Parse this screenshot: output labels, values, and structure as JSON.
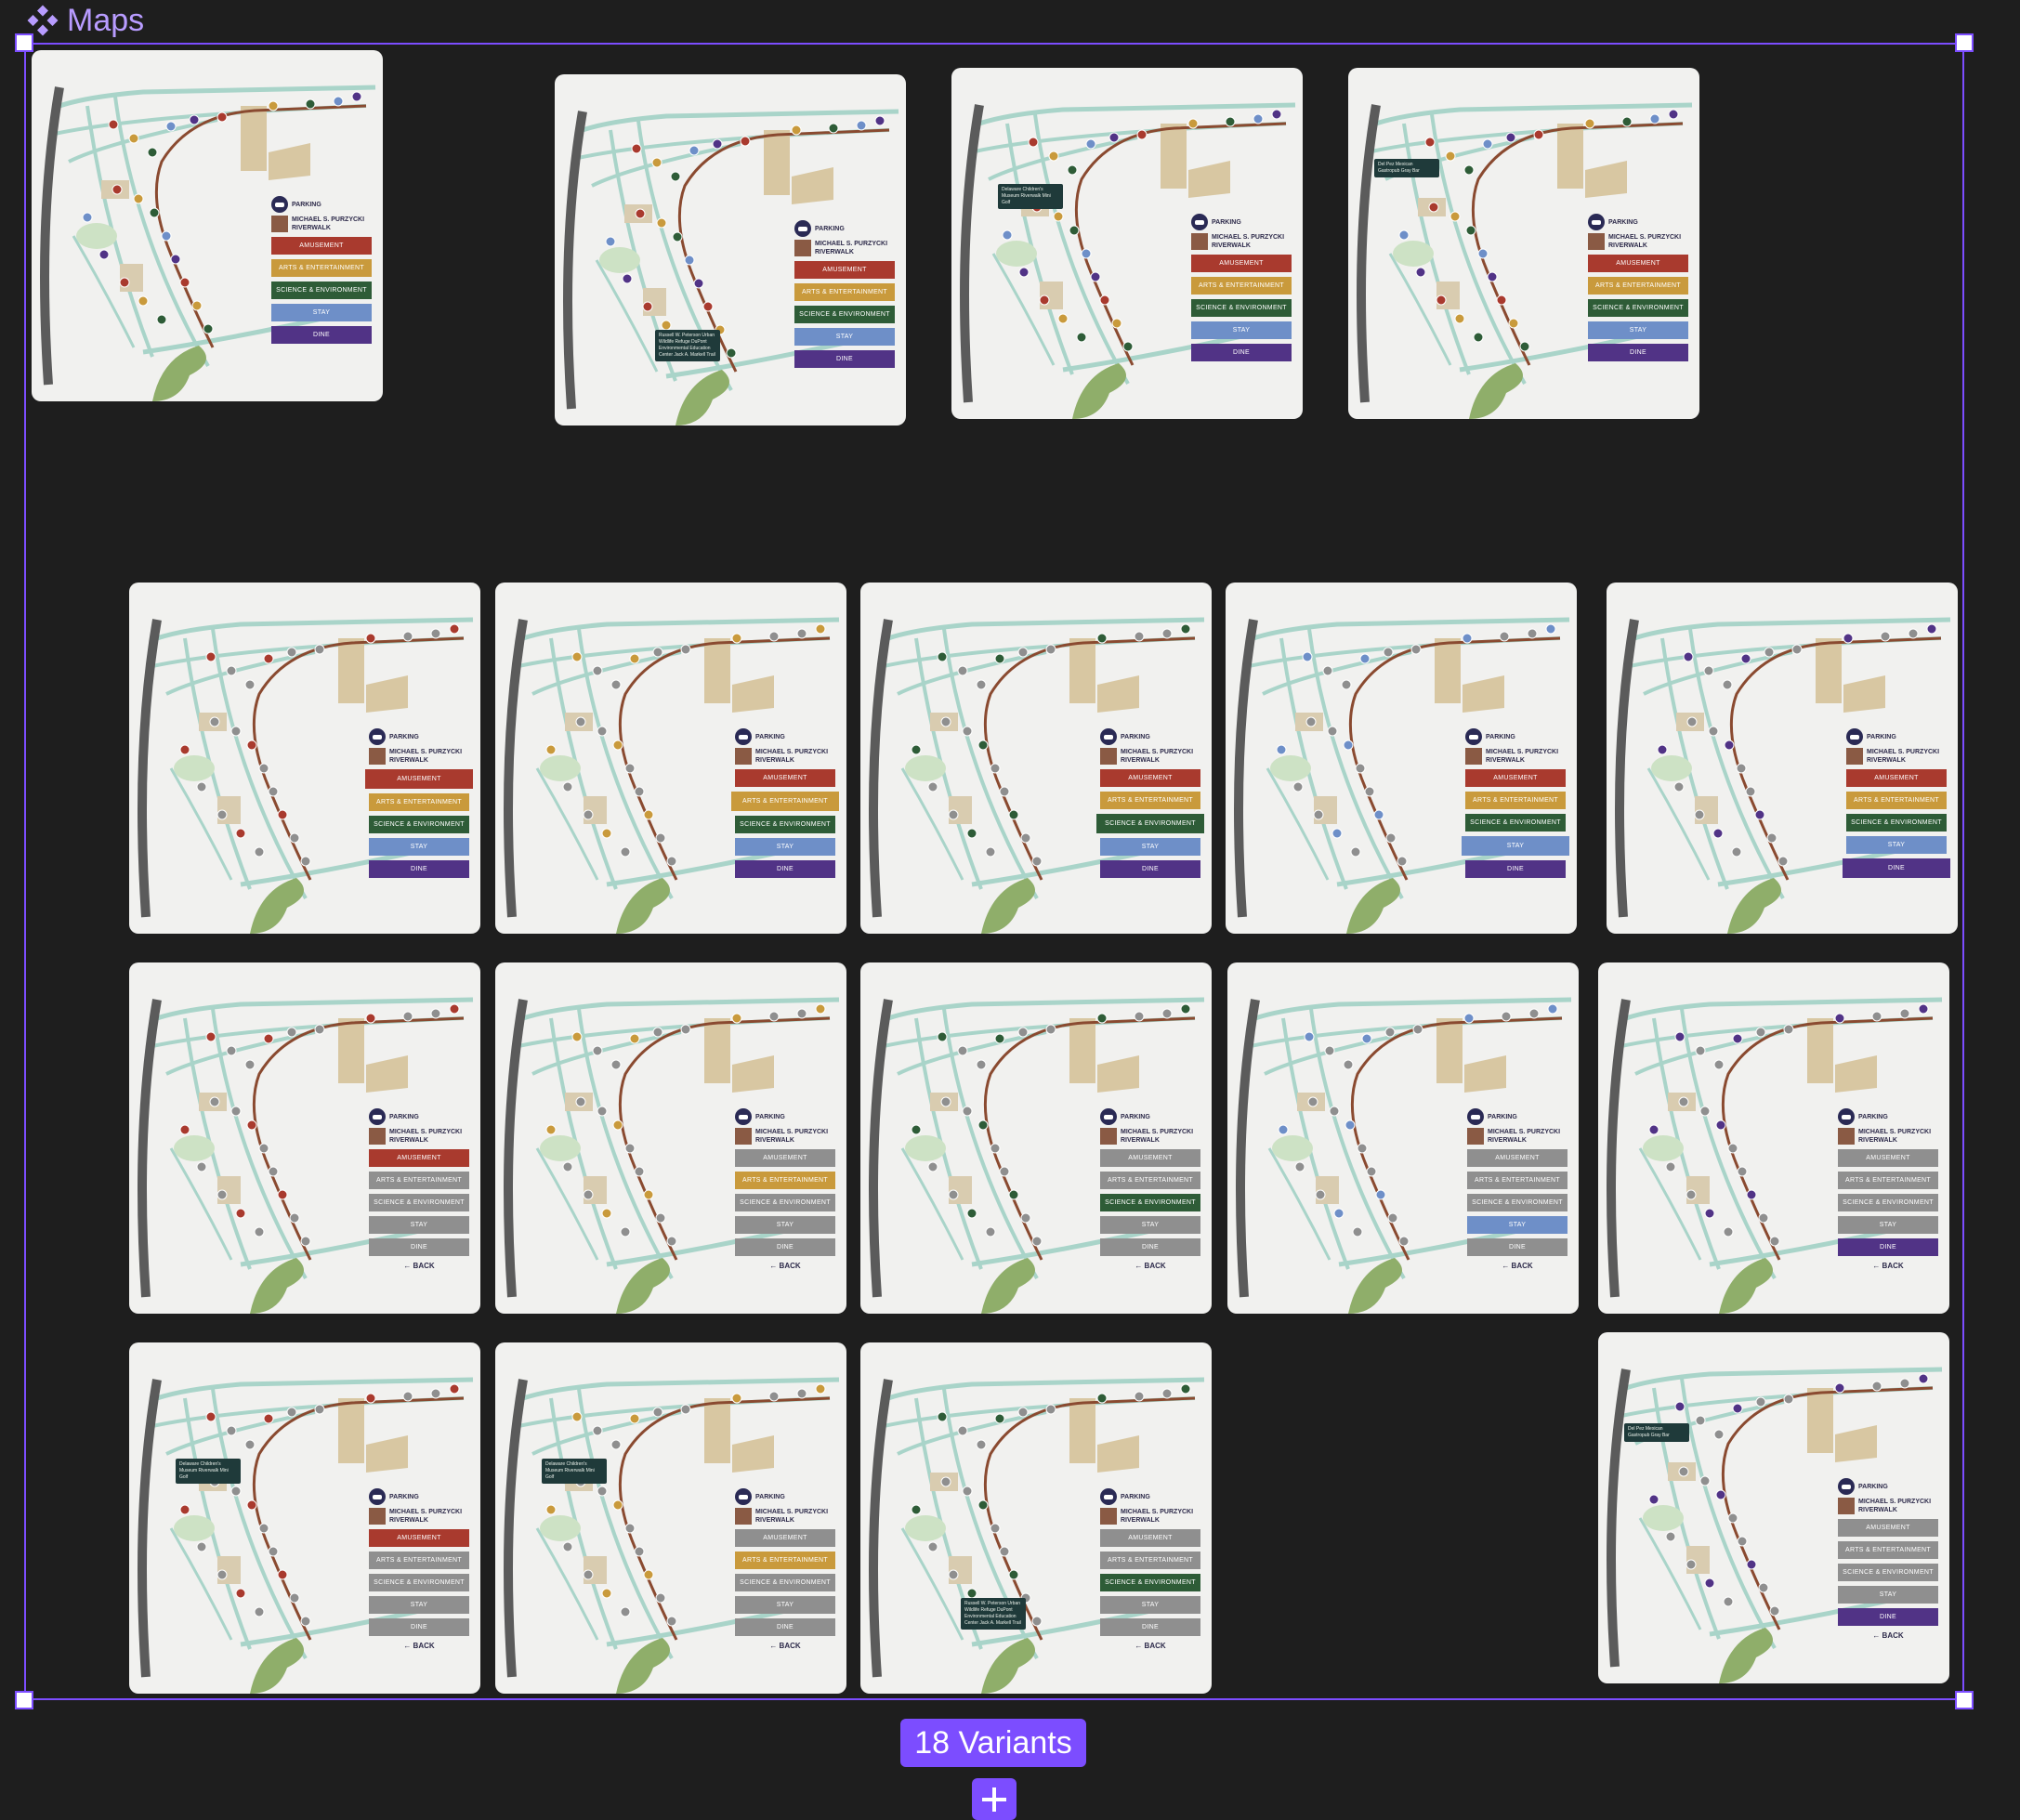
{
  "title": "Maps",
  "variants_label": "18 Variants",
  "colors": {
    "amusement": "#a93a2e",
    "arts": "#c99a3c",
    "science": "#2e5c37",
    "stay": "#6e8fc8",
    "dine": "#513386",
    "inactive": "#8f8f8f",
    "selection": "#7c4dff"
  },
  "legend": {
    "parking": "PARKING",
    "riverwalk": "MICHAEL S. PURZYCKI RIVERWALK",
    "back": "← BACK",
    "categories": [
      "AMUSEMENT",
      "ARTS & ENTERTAINMENT",
      "SCIENCE & ENVIRONMENT",
      "STAY",
      "DINE"
    ]
  },
  "cards": [
    {
      "active": [
        "amusement",
        "arts",
        "science",
        "stay",
        "dine"
      ],
      "back": false,
      "tip": "",
      "dots": "all"
    },
    {
      "active": [
        "amusement",
        "arts",
        "science",
        "stay",
        "dine"
      ],
      "back": false,
      "tip": "Russell W. Peterson Urban Wildlife Refuge DuPont Environmental Education Center Jack A. Markell Trail",
      "dots": "all"
    },
    {
      "active": [
        "amusement",
        "arts",
        "science",
        "stay",
        "dine"
      ],
      "back": false,
      "tip": "Delaware Children's Museum Riverwalk Mini Golf",
      "dots": "all"
    },
    {
      "active": [
        "amusement",
        "arts",
        "science",
        "stay",
        "dine"
      ],
      "back": false,
      "tip": "Del Pez Mexican Gastropub Gray Bar",
      "dots": "all"
    },
    {
      "active": [
        "amusement",
        "arts",
        "science",
        "stay",
        "dine"
      ],
      "back": false,
      "tip": "",
      "dots": "amusement",
      "highlight": "amusement"
    },
    {
      "active": [
        "amusement",
        "arts",
        "science",
        "stay",
        "dine"
      ],
      "back": false,
      "tip": "",
      "dots": "arts",
      "highlight": "arts"
    },
    {
      "active": [
        "amusement",
        "arts",
        "science",
        "stay",
        "dine"
      ],
      "back": false,
      "tip": "",
      "dots": "science",
      "highlight": "science"
    },
    {
      "active": [
        "amusement",
        "arts",
        "science",
        "stay",
        "dine"
      ],
      "back": false,
      "tip": "",
      "dots": "stay",
      "highlight": "stay"
    },
    {
      "active": [
        "amusement",
        "arts",
        "science",
        "stay",
        "dine"
      ],
      "back": false,
      "tip": "",
      "dots": "dine",
      "highlight": "dine"
    },
    {
      "active": [
        "amusement"
      ],
      "back": true,
      "tip": "",
      "dots": "amusement"
    },
    {
      "active": [
        "arts"
      ],
      "back": true,
      "tip": "",
      "dots": "arts"
    },
    {
      "active": [
        "science"
      ],
      "back": true,
      "tip": "",
      "dots": "science"
    },
    {
      "active": [
        "stay"
      ],
      "back": true,
      "tip": "",
      "dots": "stay"
    },
    {
      "active": [
        "dine"
      ],
      "back": true,
      "tip": "",
      "dots": "dine"
    },
    {
      "active": [
        "amusement"
      ],
      "back": true,
      "tip": "Delaware Children's Museum Riverwalk Mini Golf",
      "dots": "amusement"
    },
    {
      "active": [
        "arts"
      ],
      "back": true,
      "tip": "Delaware Children's Museum Riverwalk Mini Golf",
      "dots": "arts"
    },
    {
      "active": [
        "science"
      ],
      "back": true,
      "tip": "Russell W. Peterson Urban Wildlife Refuge DuPont Environmental Education Center Jack A. Markell Trail",
      "dots": "science"
    },
    {
      "active": [
        "dine"
      ],
      "back": true,
      "tip": "Del Pez Mexican Gastropub Gray Bar",
      "dots": "dine"
    }
  ]
}
